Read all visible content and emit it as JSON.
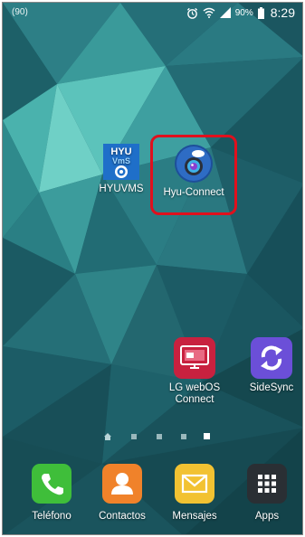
{
  "status_bar": {
    "left_indicator": "(90)",
    "battery_percent": "90%",
    "time": "8:29"
  },
  "icons": {
    "status_alarm": "alarm-icon",
    "status_wifi": "wifi-icon",
    "status_signal": "signal-icon",
    "status_battery": "battery-icon"
  },
  "home_apps": [
    {
      "label": "HYUVMS",
      "logo_text_top": "HYU",
      "logo_text_mid": "VmS"
    },
    {
      "label": "Hyu-Connect"
    },
    {
      "label": "LG webOS Connect",
      "label_line1": "LG webOS",
      "label_line2": "Connect"
    },
    {
      "label": "SideSync"
    }
  ],
  "page_indicator": {
    "pages": 5,
    "current_page": 5
  },
  "dock": [
    {
      "label": "Teléfono"
    },
    {
      "label": "Contactos"
    },
    {
      "label": "Mensajes"
    },
    {
      "label": "Apps"
    }
  ],
  "colors": {
    "highlight": "#e0101d",
    "phone_green": "#3fbe3a",
    "contacts_orange": "#f0822a",
    "messages_yellow": "#f2c232",
    "apps_dark": "#2a2f34",
    "hyuvms_blue": "#1f6fc9",
    "sidesync_purple": "#6b4fd8"
  }
}
